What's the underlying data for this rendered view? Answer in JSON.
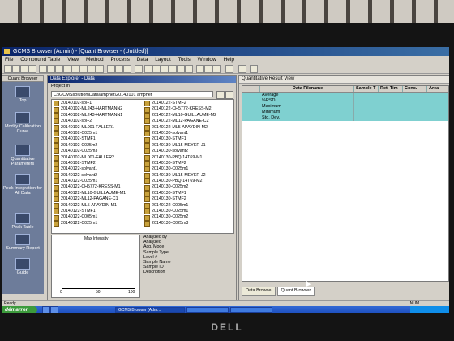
{
  "window": {
    "title": "GCMS Browser (Admin) - [Quant Browser - (Untitled)]",
    "menu": [
      "File",
      "Compound Table",
      "View",
      "Method",
      "Process",
      "Data",
      "Layout",
      "Tools",
      "Window",
      "Help"
    ]
  },
  "quant_browser": {
    "header": "Quant Browser",
    "items": [
      {
        "label": "Top"
      },
      {
        "label": "Modify Calibration Curve"
      },
      {
        "label": "Quantitative Parameters"
      },
      {
        "label": "Peak Integration for All Data"
      },
      {
        "label": "Peak Table"
      },
      {
        "label": "Summary Report"
      },
      {
        "label": "Guide"
      }
    ]
  },
  "data_explorer": {
    "title": "Data Explorer - Data",
    "project_label": "Project in",
    "path": "C:\\GCMSsolution\\Data\\amphet\\20140101 amphet",
    "files_col1": [
      "20140102-sol+1",
      "20140102-ML243-HARTMANN2",
      "20140102-ML243-HARTMANN1",
      "20140102-sol+2",
      "20140102-ML001-FALLER1",
      "20140102-C025m1",
      "20140102-STMF1",
      "20140102-C025m2",
      "20140102-C025m3",
      "20140102-ML001-FALLER2",
      "20140102-STMF2",
      "20140122-solvant1",
      "20140122-solvant2",
      "20140122-C025m1",
      "20140122-CH5772-KRESS-M1",
      "20140122-ML10-GUILLAUME-M1",
      "20140122-ML12-PAGANE-C1",
      "20140122-ML5-APAYDIN-M1",
      "20140122-STMF1",
      "20140122-C005m1",
      "20140122-C025m1"
    ],
    "files_col2": [
      "20140122-STMF2",
      "20140122-CH5772-KRESS-M2",
      "20140122-ML10-GUILLAUME-M2",
      "20140122-ML12-PAGANE-C2",
      "20140122-ML5-APAYDIN-M2",
      "20140130-solvant1",
      "20140130-STMF1",
      "20140130-ML15-MEYER-J1",
      "20140130-solvant2",
      "20140130-PBQ-14T69-M1",
      "20140130-STMF2",
      "20140130-C025m1",
      "20140130-ML15-MEYER-J2",
      "20140130-PBQ-14T69-M2",
      "20140130-C025m2",
      "20140130-STMF1",
      "20140130-STMF2",
      "20140122-C005m1",
      "20140130-C025m1",
      "20140130-C025m2",
      "20140130-C025m3"
    ],
    "mini_chart": {
      "title": "Max Intensity",
      "ticks": [
        "0",
        "50",
        "100"
      ]
    },
    "info_fields": [
      "Analyzed by",
      "Analyzed",
      "Acq. Mode",
      "Sample Type",
      "Level #",
      "Sample Name",
      "Sample ID",
      "Description"
    ]
  },
  "quant_result": {
    "title": "Quantitative Result View",
    "columns": [
      "Data Filename",
      "Sample T",
      "Ret. Tim",
      "Conc.",
      "Area"
    ],
    "rows": [
      "Average",
      "%RSD",
      "Maximum",
      "Minimum",
      "Std. Dev."
    ],
    "tabs": [
      "Data Browse",
      "Quant Browser"
    ]
  },
  "status": {
    "left": "Ready",
    "right": "NUM"
  },
  "taskbar": {
    "start": "démarrer",
    "tasks": [
      "GCMS Browser (Adm..."
    ]
  },
  "monitor_brand": "DELL",
  "colors": {
    "title_bar": "#0a246a",
    "stat_rows": "#7fd0d0",
    "taskbar": "#1d4fbf",
    "start": "#3c9b3c"
  }
}
